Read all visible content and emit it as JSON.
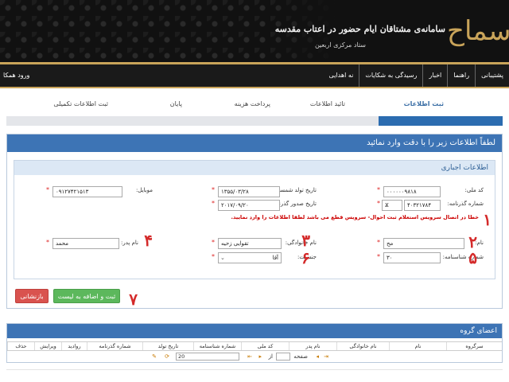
{
  "banner": {
    "logo_text": "سماح",
    "tagline": "سامانه‌ی مشتاقان ایام حضور در اعتاب مقدسه",
    "subtagline": "ستاد مرکزی اربعین"
  },
  "nav": {
    "items": [
      "نه اهدایی",
      "رسیدگی به شکایات",
      "اخبار",
      "راهنما",
      "پشتیبانی"
    ],
    "login": "ورود همکا"
  },
  "steps": {
    "items": [
      "ثبت اطلاعات",
      "تائید اطلاعات",
      "پرداخت هزینه",
      "پایان",
      "ثبت اطلاعات تکمیلی"
    ],
    "progress": 0.25
  },
  "main": {
    "header": "لطفاً اطلاعات زیر را با دقت وارد نمائید",
    "section_title": "اطلاعات اجباری",
    "fields": {
      "national_code_label": "کد ملی:",
      "national_code_value": "۰۰۰۰۰۰۹۸۱۸",
      "birth_date_label": "تاریخ تولد شمسی:",
      "birth_date_value": "۱۳۵۵/۰۳/۲۸",
      "mobile_label": "موبایل:",
      "mobile_value": "۰۹۱۲۷۴۲۱۵۱۳",
      "passport_label": "شماره گذرنامه:",
      "passport_prefix": "X",
      "passport_value": "۴۰۳۲۱۷۸۴",
      "passport_issue_label": "تاریخ صدور گذرنامه:",
      "passport_issue_value": "۲۰۱۷/۰۹/۲۰",
      "error_message": "خطا در اتصال سرویس استعلام ثبت احوال- سرویس قطع می باشد لطفا اطلاعات را وارد نمایید.",
      "first_name_label": "نام:",
      "first_name_value": "مح",
      "last_name_label": "نام خانوادگی:",
      "last_name_value": "تقوایی زحیه",
      "father_name_label": "نام پدر:",
      "father_name_value": "محمد",
      "id_number_label": "شماره شناسنامه:",
      "id_number_value": "۳۰",
      "gender_label": "جنسیت:",
      "gender_value": "آقا"
    },
    "annotations": [
      "۱",
      "۲",
      "۳",
      "۴",
      "۵",
      "۶",
      "۷"
    ],
    "buttons": {
      "submit": "ثبت و اضافه به لیست",
      "reset": "بازنشانی"
    }
  },
  "members": {
    "title": "اعضای گروه",
    "columns": [
      "سرگروه",
      "نام",
      "نام خانوادگی",
      "نام پدر",
      "کد ملی",
      "شماره شناسنامه",
      "تاریخ تولد",
      "شماره گذرنامه",
      "روادید",
      "ویرایش",
      "حذف"
    ],
    "pager": {
      "page_word": "صفحه",
      "page_value": "",
      "of_word": "از",
      "page_size": "20"
    }
  },
  "colors": {
    "primary": "#3d74b5",
    "gold": "#c9a45a",
    "error": "#cc0000",
    "annotation": "#d42a2a",
    "submit": "#5cb85c",
    "reset": "#d9534f"
  }
}
